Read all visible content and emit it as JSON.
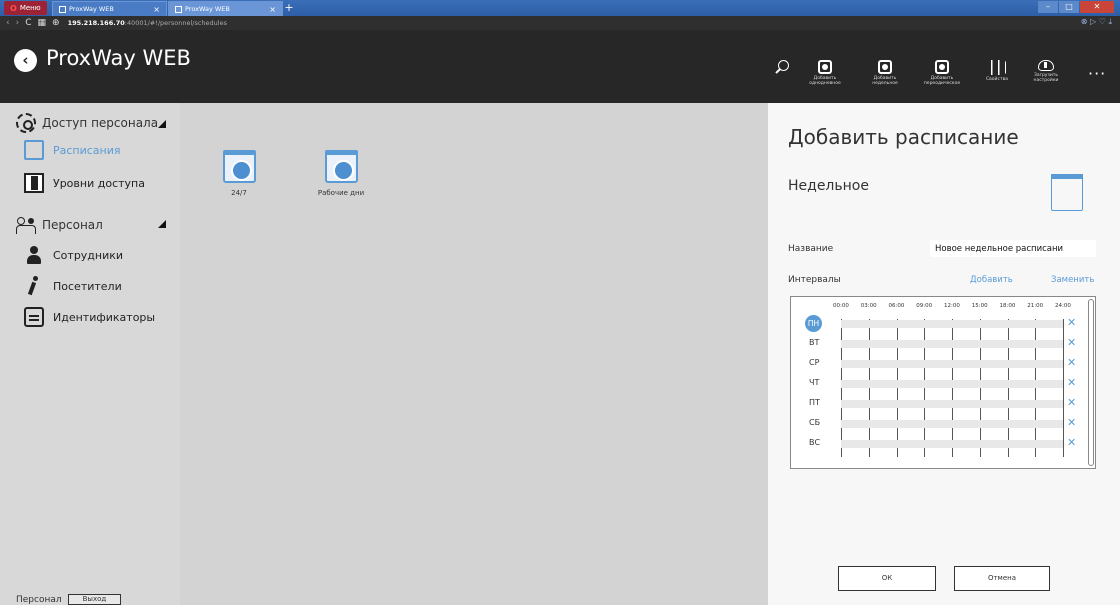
{
  "browser": {
    "menu_label": "Меню",
    "tabs": [
      {
        "title": "ProxWay WEB"
      },
      {
        "title": "ProxWay WEB"
      }
    ],
    "url_host": "195.218.166.70",
    "url_rest": ":40001/#!/personnel/schedules"
  },
  "header": {
    "title": "ProxWay WEB",
    "tools": [
      {
        "line1": "Добавить",
        "line2": "однодневное"
      },
      {
        "line1": "Добавить",
        "line2": "недельное"
      },
      {
        "line1": "Добавить",
        "line2": "переодическое"
      },
      {
        "line1": "Свойства",
        "line2": ""
      },
      {
        "line1": "Загрузить",
        "line2": "настройки"
      }
    ]
  },
  "sidebar": {
    "group_access": "Доступ персонала",
    "item_schedules": "Расписания",
    "item_access_levels": "Уровни доступа",
    "group_personnel": "Персонал",
    "item_employees": "Сотрудники",
    "item_visitors": "Посетители",
    "item_identifiers": "Идентификаторы",
    "footer_label": "Персонал",
    "footer_exit": "Выход",
    "accent": "#5b9bd5"
  },
  "main": {
    "tiles": [
      {
        "label": "24/7"
      },
      {
        "label": "Рабочие дни"
      }
    ]
  },
  "panel": {
    "title": "Добавить расписание",
    "subtitle": "Недельное",
    "name_label": "Название",
    "name_value": "Новое недельное расписани",
    "intervals_label": "Интервалы",
    "add_link": "Добавить",
    "replace_link": "Заменить",
    "times": [
      "00:00",
      "03:00",
      "06:00",
      "09:00",
      "12:00",
      "15:00",
      "18:00",
      "21:00",
      "24:00"
    ],
    "days": [
      "ПН",
      "ВТ",
      "СР",
      "ЧТ",
      "ПТ",
      "СБ",
      "ВС"
    ],
    "remove_glyph": "✕",
    "ok": "ОК",
    "cancel": "Отмена"
  }
}
